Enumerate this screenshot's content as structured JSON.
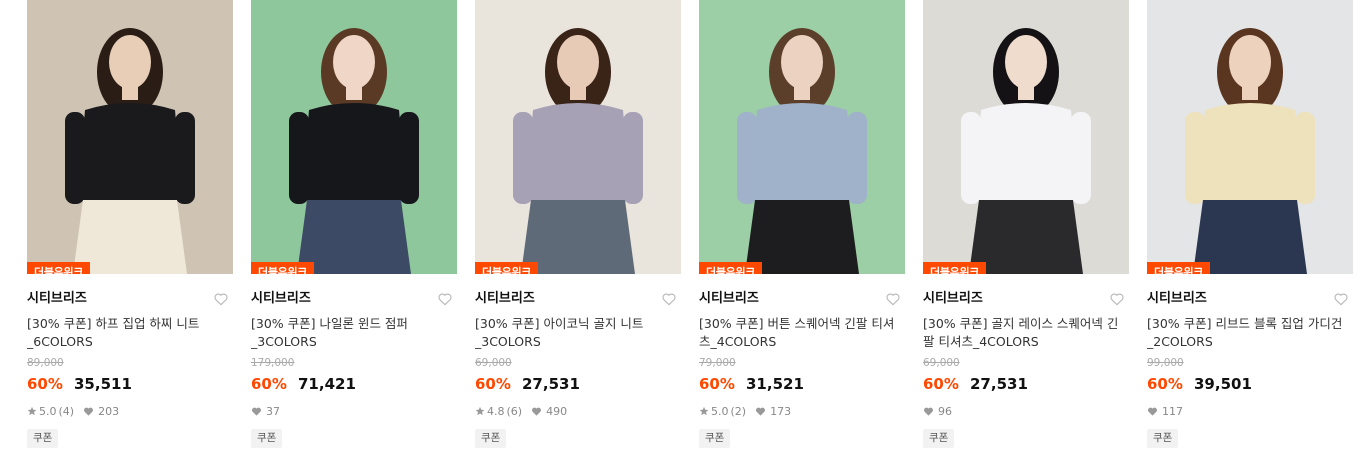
{
  "theme": {
    "accent": "#ff4800",
    "heart": "#b5b5b5"
  },
  "products": [
    {
      "badge": "더블유위크",
      "brand": "시티브리즈",
      "title": "[30% 쿠폰] 하프 집업 하찌 니트 _6COLORS",
      "original_price": "89,000",
      "discount": "60%",
      "price": "35,511",
      "rating": "5.0",
      "reviews": "(4)",
      "likes": "203",
      "coupon": "쿠폰",
      "photo": {
        "bg": "#cfc4b4",
        "top": "#1a1a1d",
        "bottom": "#efe8d9",
        "hair": "#2a1d16",
        "skin": "#e8cdb7"
      }
    },
    {
      "badge": "더블유위크",
      "brand": "시티브리즈",
      "title": "[30% 쿠폰] 나일론 윈드 점퍼 _3COLORS",
      "original_price": "179,000",
      "discount": "60%",
      "price": "71,421",
      "rating": "",
      "reviews": "",
      "likes": "37",
      "coupon": "쿠폰",
      "photo": {
        "bg": "#8fc79c",
        "top": "#16171b",
        "bottom": "#3d4a66",
        "hair": "#5a3a25",
        "skin": "#efd6c6"
      }
    },
    {
      "badge": "더블유위크",
      "brand": "시티브리즈",
      "title": "[30% 쿠폰] 아이코닉 골지 니트 _3COLORS",
      "original_price": "69,000",
      "discount": "60%",
      "price": "27,531",
      "rating": "4.8",
      "reviews": "(6)",
      "likes": "490",
      "coupon": "쿠폰",
      "photo": {
        "bg": "#e9e4dc",
        "top": "#a6a1b5",
        "bottom": "#5f6a78",
        "hair": "#3a2418",
        "skin": "#e8cbb6"
      }
    },
    {
      "badge": "더블유위크",
      "brand": "시티브리즈",
      "title": "[30% 쿠폰] 버튼 스퀘어넥 긴팔 티셔츠_4COLORS",
      "original_price": "79,000",
      "discount": "60%",
      "price": "31,521",
      "rating": "5.0",
      "reviews": "(2)",
      "likes": "173",
      "coupon": "쿠폰",
      "photo": {
        "bg": "#9ccfa5",
        "top": "#9fb2c9",
        "bottom": "#1d1d20",
        "hair": "#5b3f2a",
        "skin": "#ecd3c1"
      }
    },
    {
      "badge": "더블유위크",
      "brand": "시티브리즈",
      "title": "[30% 쿠폰] 골지 레이스 스퀘어넥 긴팔 티셔츠_4COLORS",
      "original_price": "69,000",
      "discount": "60%",
      "price": "27,531",
      "rating": "",
      "reviews": "",
      "likes": "96",
      "coupon": "쿠폰",
      "photo": {
        "bg": "#dcdbd6",
        "top": "#f4f4f6",
        "bottom": "#2a2a2c",
        "hair": "#141214",
        "skin": "#f0dccd"
      }
    },
    {
      "badge": "더블유위크",
      "brand": "시티브리즈",
      "title": "[30% 쿠폰] 리브드 블록 집업 가디건 _2COLORS",
      "original_price": "99,000",
      "discount": "60%",
      "price": "39,501",
      "rating": "",
      "reviews": "",
      "likes": "117",
      "coupon": "쿠폰",
      "photo": {
        "bg": "#e3e5e6",
        "top": "#eee2bd",
        "bottom": "#2b3650",
        "hair": "#5a3520",
        "skin": "#edd2be"
      }
    }
  ]
}
